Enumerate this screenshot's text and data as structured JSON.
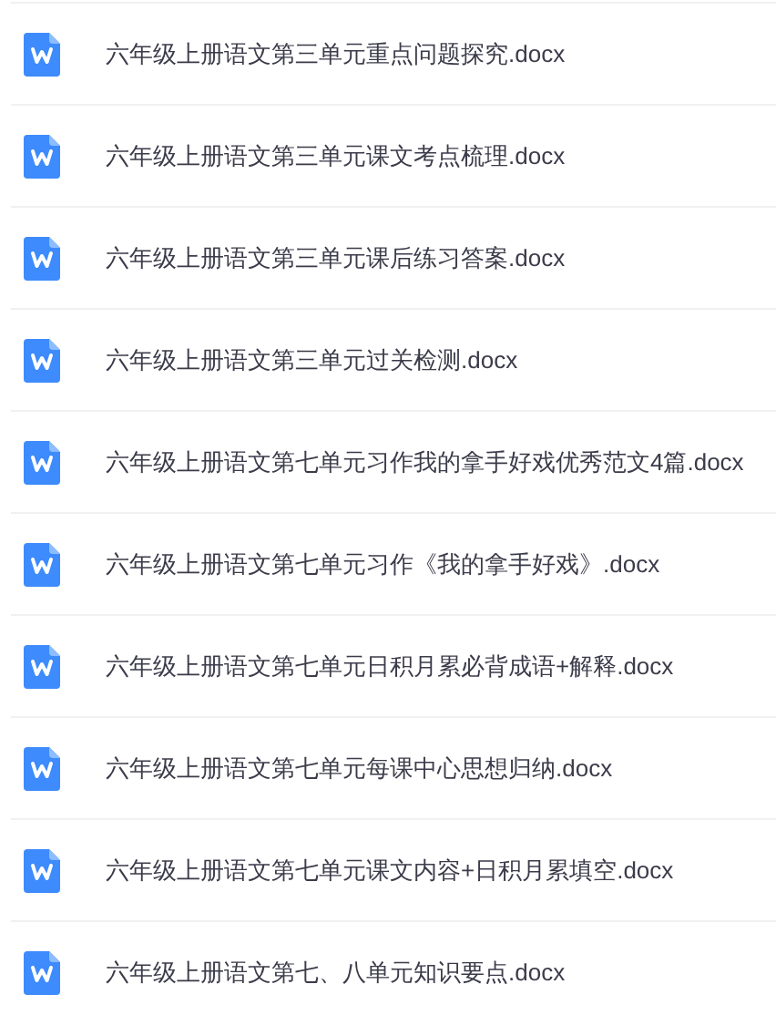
{
  "files": [
    {
      "name": "六年级上册语文第三单元重点问题探究.docx"
    },
    {
      "name": "六年级上册语文第三单元课文考点梳理.docx"
    },
    {
      "name": "六年级上册语文第三单元课后练习答案.docx"
    },
    {
      "name": "六年级上册语文第三单元过关检测.docx"
    },
    {
      "name": "六年级上册语文第七单元习作我的拿手好戏优秀范文4篇.docx"
    },
    {
      "name": "六年级上册语文第七单元习作《我的拿手好戏》.docx"
    },
    {
      "name": "六年级上册语文第七单元日积月累必背成语+解释.docx"
    },
    {
      "name": "六年级上册语文第七单元每课中心思想归纳.docx"
    },
    {
      "name": "六年级上册语文第七单元课文内容+日积月累填空.docx"
    },
    {
      "name": "六年级上册语文第七、八单元知识要点.docx"
    }
  ]
}
